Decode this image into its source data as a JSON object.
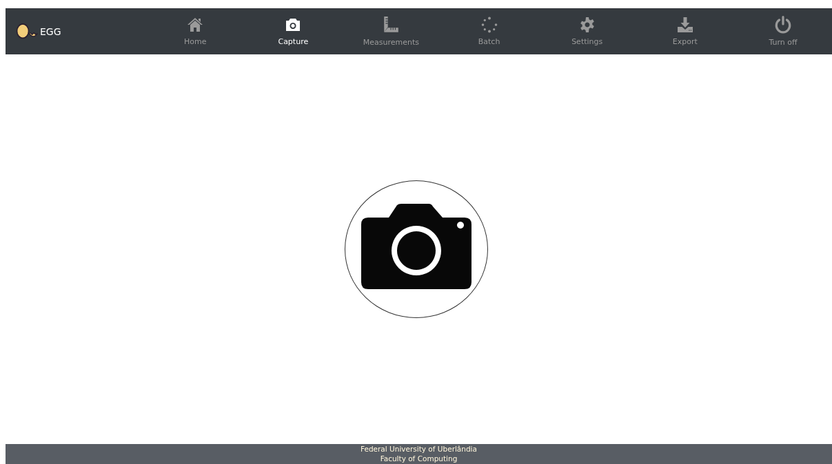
{
  "brand": {
    "name": "EGG"
  },
  "nav": [
    {
      "kind": "home",
      "label": "Home",
      "selected": false
    },
    {
      "kind": "camera",
      "label": "Capture",
      "selected": true
    },
    {
      "kind": "ruler",
      "label": "Measurements",
      "selected": false
    },
    {
      "kind": "spinner",
      "label": "Batch",
      "selected": false
    },
    {
      "kind": "gear",
      "label": "Settings",
      "selected": false
    },
    {
      "kind": "download",
      "label": "Export",
      "selected": false
    },
    {
      "kind": "power",
      "label": "Turn off",
      "selected": false
    }
  ],
  "footer": {
    "lines": [
      "Federal University of Uberlândia",
      "Faculty of Computing"
    ]
  }
}
